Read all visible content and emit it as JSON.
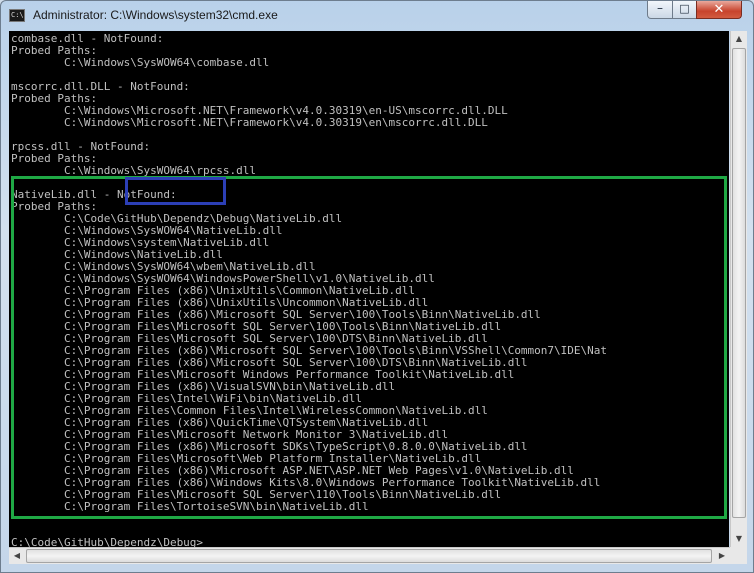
{
  "window": {
    "icon_text": "C:\\",
    "title": "Administrator: C:\\Windows\\system32\\cmd.exe",
    "minimize_label": "–",
    "maximize_label": "□",
    "close_label": "✕"
  },
  "console": {
    "lines": [
      "combase.dll - NotFound:",
      "Probed Paths:",
      "        C:\\Windows\\SysWOW64\\combase.dll",
      "",
      "mscorrc.dll.DLL - NotFound:",
      "Probed Paths:",
      "        C:\\Windows\\Microsoft.NET\\Framework\\v4.0.30319\\en-US\\mscorrc.dll.DLL",
      "        C:\\Windows\\Microsoft.NET\\Framework\\v4.0.30319\\en\\mscorrc.dll.DLL",
      "",
      "rpcss.dll - NotFound:",
      "Probed Paths:",
      "        C:\\Windows\\SysWOW64\\rpcss.dll",
      "",
      "NativeLib.dll - NotFound:",
      "Probed Paths:",
      "        C:\\Code\\GitHub\\Dependz\\Debug\\NativeLib.dll",
      "        C:\\Windows\\SysWOW64\\NativeLib.dll",
      "        C:\\Windows\\system\\NativeLib.dll",
      "        C:\\Windows\\NativeLib.dll",
      "        C:\\Windows\\SysWOW64\\wbem\\NativeLib.dll",
      "        C:\\Windows\\SysWOW64\\WindowsPowerShell\\v1.0\\NativeLib.dll",
      "        C:\\Program Files (x86)\\UnixUtils\\Common\\NativeLib.dll",
      "        C:\\Program Files (x86)\\UnixUtils\\Uncommon\\NativeLib.dll",
      "        C:\\Program Files (x86)\\Microsoft SQL Server\\100\\Tools\\Binn\\NativeLib.dll",
      "        C:\\Program Files\\Microsoft SQL Server\\100\\Tools\\Binn\\NativeLib.dll",
      "        C:\\Program Files\\Microsoft SQL Server\\100\\DTS\\Binn\\NativeLib.dll",
      "        C:\\Program Files (x86)\\Microsoft SQL Server\\100\\Tools\\Binn\\VSShell\\Common7\\IDE\\Nat",
      "        C:\\Program Files (x86)\\Microsoft SQL Server\\100\\DTS\\Binn\\NativeLib.dll",
      "        C:\\Program Files\\Microsoft Windows Performance Toolkit\\NativeLib.dll",
      "        C:\\Program Files (x86)\\VisualSVN\\bin\\NativeLib.dll",
      "        C:\\Program Files\\Intel\\WiFi\\bin\\NativeLib.dll",
      "        C:\\Program Files\\Common Files\\Intel\\WirelessCommon\\NativeLib.dll",
      "        C:\\Program Files (x86)\\QuickTime\\QTSystem\\NativeLib.dll",
      "        C:\\Program Files\\Microsoft Network Monitor 3\\NativeLib.dll",
      "        C:\\Program Files (x86)\\Microsoft SDKs\\TypeScript\\0.8.0.0\\NativeLib.dll",
      "        C:\\Program Files\\Microsoft\\Web Platform Installer\\NativeLib.dll",
      "        C:\\Program Files (x86)\\Microsoft ASP.NET\\ASP.NET Web Pages\\v1.0\\NativeLib.dll",
      "        C:\\Program Files (x86)\\Windows Kits\\8.0\\Windows Performance Toolkit\\NativeLib.dll",
      "        C:\\Program Files\\Microsoft SQL Server\\110\\Tools\\Binn\\NativeLib.dll",
      "        C:\\Program Files\\TortoiseSVN\\bin\\NativeLib.dll",
      "",
      "",
      "C:\\Code\\GitHub\\Dependz\\Debug>"
    ]
  },
  "annotations": {
    "highlight_color": "#1fa845",
    "notfound_box_color": "#2c3fb6"
  },
  "scrollbars": {
    "up_arrow": "▲",
    "down_arrow": "▼",
    "left_arrow": "◀",
    "right_arrow": "▶"
  }
}
